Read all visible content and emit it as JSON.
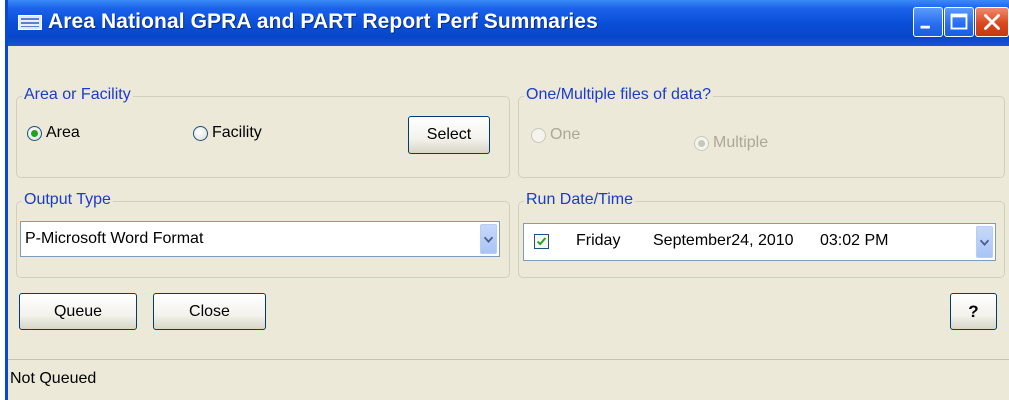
{
  "window": {
    "title": "Area National GPRA and PART Report Perf Summaries",
    "icon": "app-window-icon",
    "controls": [
      "minimize-icon",
      "maximize-icon",
      "close-icon"
    ]
  },
  "area_or_facility": {
    "legend": "Area or Facility",
    "options": [
      "Area",
      "Facility"
    ],
    "selected": "Area",
    "select_button": "Select"
  },
  "files_of_data": {
    "legend": "One/Multiple files of data?",
    "options": [
      "One",
      "Multiple"
    ],
    "selected": "Multiple",
    "enabled": false
  },
  "output_type": {
    "legend": "Output Type",
    "value": "P-Microsoft Word Format"
  },
  "run_datetime": {
    "legend": "Run Date/Time",
    "checked": true,
    "day": "Friday",
    "date": "September24, 2010",
    "time": "03:02 PM"
  },
  "actions": {
    "queue": "Queue",
    "close": "Close",
    "help": "?"
  },
  "status": {
    "text": "Not Queued"
  },
  "colors": {
    "titlebar": "#0a4fd8",
    "window_bg": "#ece9d8",
    "group_label": "#1a3cc8",
    "close_button": "#d9491f"
  }
}
